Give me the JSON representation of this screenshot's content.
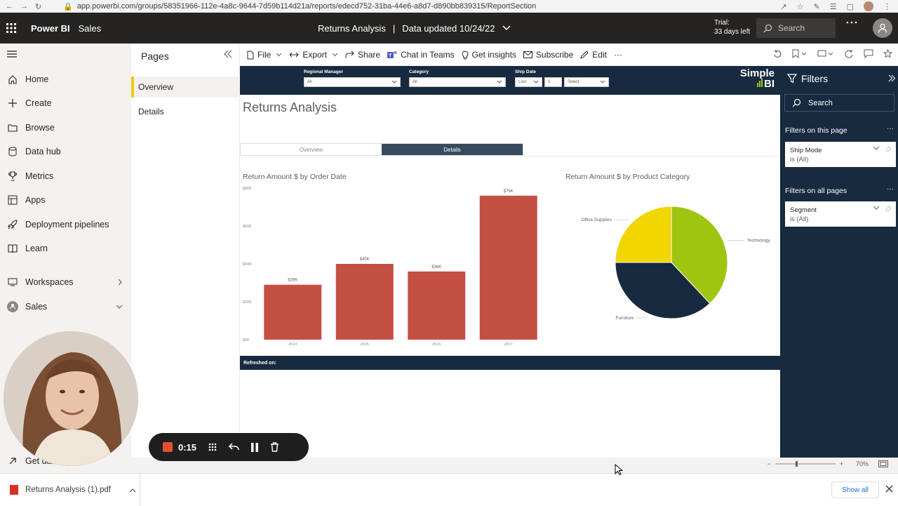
{
  "browser": {
    "url": "app.powerbi.com/groups/58351966-112e-4a8c-9644-7d59b114d21a/reports/edecd752-31ba-44e6-a8d7-d890bb839315/ReportSection"
  },
  "header": {
    "brand": "Power BI",
    "workspace": "Sales",
    "report_title": "Returns Analysis",
    "sep": "|",
    "data_updated": "Data updated 10/24/22",
    "trial_line1": "Trial:",
    "trial_line2": "33 days left",
    "search_placeholder": "Search"
  },
  "nav": {
    "items": [
      {
        "label": "Home",
        "icon": "home-icon"
      },
      {
        "label": "Create",
        "icon": "plus-icon"
      },
      {
        "label": "Browse",
        "icon": "folder-icon"
      },
      {
        "label": "Data hub",
        "icon": "database-icon"
      },
      {
        "label": "Metrics",
        "icon": "trophy-icon"
      },
      {
        "label": "Apps",
        "icon": "apps-icon"
      },
      {
        "label": "Deployment pipelines",
        "icon": "rocket-icon"
      },
      {
        "label": "Learn",
        "icon": "book-icon"
      },
      {
        "label": "Workspaces",
        "icon": "workspaces-icon"
      },
      {
        "label": "Sales",
        "icon": "workspace-avatar-icon"
      }
    ],
    "get_data": "Get data"
  },
  "pages": {
    "title": "Pages",
    "items": [
      {
        "label": "Overview"
      },
      {
        "label": "Details"
      }
    ]
  },
  "actions": {
    "file": "File",
    "export": "Export",
    "share": "Share",
    "chat_in_teams": "Chat in Teams",
    "get_insights": "Get insights",
    "subscribe": "Subscribe",
    "edit": "Edit",
    "more": "···"
  },
  "report": {
    "slicers": {
      "regional_manager": {
        "label": "Regional Manager",
        "value": "All"
      },
      "category": {
        "label": "Category",
        "value": "All"
      },
      "ship_date": {
        "label": "Ship Date",
        "period": "Last",
        "count": "1",
        "unit": "Select"
      }
    },
    "logo_line1": "Simple",
    "logo_line2": "BI",
    "title": "Returns Analysis",
    "tabs": [
      "Overview",
      "Details"
    ],
    "bar_title": "Return Amount $ by Order Date",
    "pie_title": "Return Amount $ by Product Category",
    "refreshed": "Refreshed on:"
  },
  "chart_data": [
    {
      "type": "bar",
      "title": "Return Amount $ by Order Date",
      "categories": [
        "2014",
        "2015",
        "2016",
        "2017"
      ],
      "values": [
        29,
        40,
        36,
        76
      ],
      "value_labels": [
        "$29K",
        "$40K",
        "$36K",
        "$76K"
      ],
      "y_ticks": [
        "$0K",
        "$20K",
        "$40K",
        "$60K",
        "$80K"
      ],
      "ylim": [
        0,
        80
      ],
      "color": "#c44f43"
    },
    {
      "type": "pie",
      "title": "Return Amount $ by Product Category",
      "slices": [
        {
          "label": "Technology",
          "value": 38,
          "color": "#9fc511"
        },
        {
          "label": "Furniture",
          "value": 37,
          "color": "#172a3f"
        },
        {
          "label": "Office Supplies",
          "value": 25,
          "color": "#f2d600"
        }
      ]
    }
  ],
  "filters": {
    "title": "Filters",
    "search_placeholder": "Search",
    "on_page_label": "Filters on this page",
    "all_pages_label": "Filters on all pages",
    "page_filters": [
      {
        "field": "Ship Mode",
        "value": "is (All)"
      }
    ],
    "all_filters": [
      {
        "field": "Segment",
        "value": "is (All)"
      }
    ]
  },
  "status": {
    "zoom": "70%"
  },
  "recorder": {
    "time": "0:15"
  },
  "download": {
    "file": "Returns Analysis (1).pdf",
    "show_all": "Show all"
  }
}
